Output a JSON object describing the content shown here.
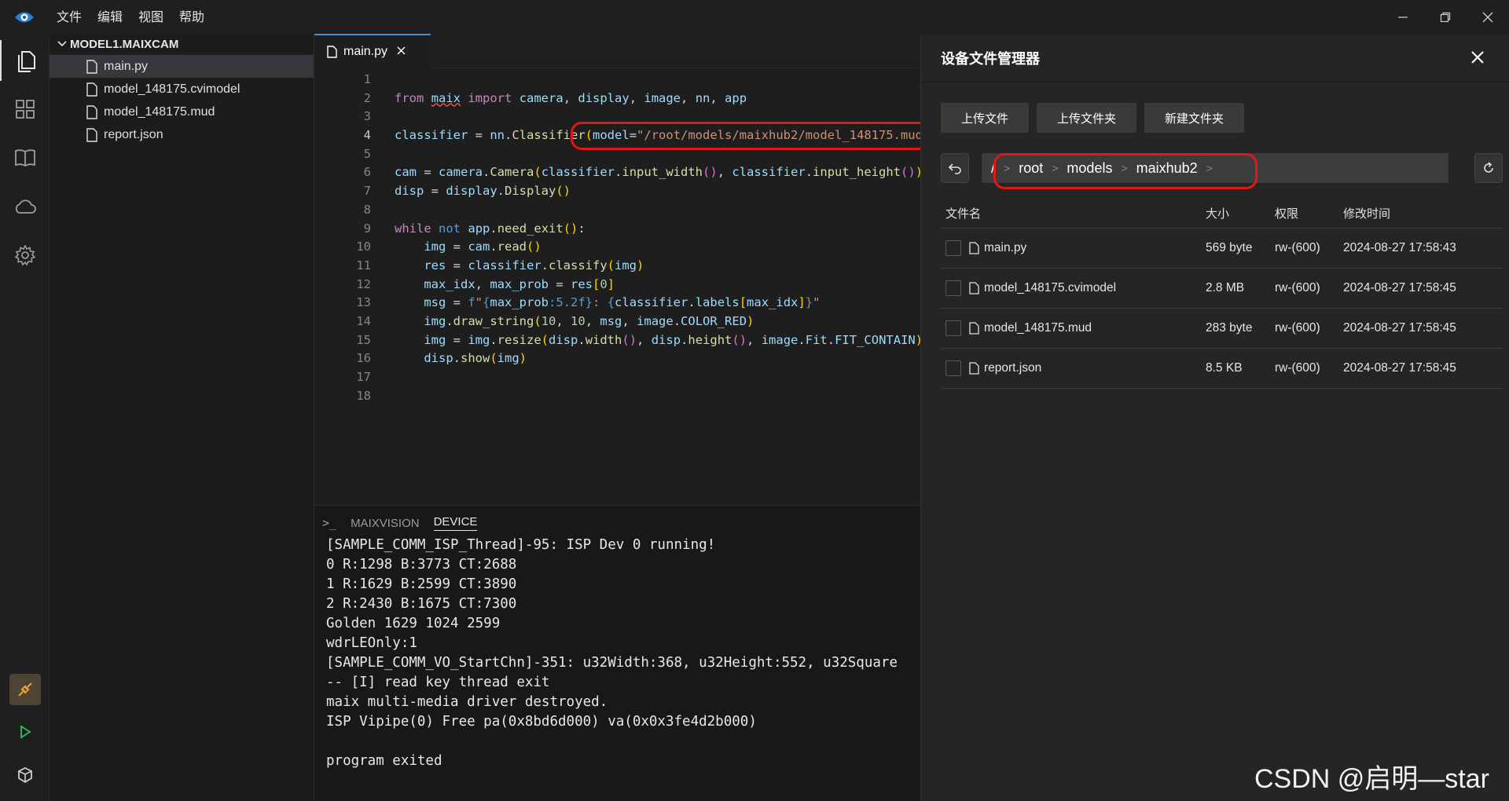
{
  "menu": [
    "文件",
    "编辑",
    "视图",
    "帮助"
  ],
  "explorer": {
    "title": "MODEL1.MAIXCAM",
    "files": [
      "main.py",
      "model_148175.cvimodel",
      "model_148175.mud",
      "report.json"
    ]
  },
  "editor": {
    "tab_label": "main.py",
    "line_numbers": [
      "1",
      "2",
      "3",
      "4",
      "5",
      "6",
      "7",
      "8",
      "9",
      "10",
      "11",
      "12",
      "13",
      "14",
      "15",
      "16",
      "17",
      "18"
    ],
    "current_line": 4
  },
  "panel": {
    "tabs": [
      "MAIXVISION",
      "DEVICE"
    ],
    "active_tab": "DEVICE",
    "output": [
      "[SAMPLE_COMM_ISP_Thread]-95: ISP Dev 0 running!",
      "0 R:1298 B:3773 CT:2688",
      "1 R:1629 B:2599 CT:3890",
      "2 R:2430 B:1675 CT:7300",
      "Golden 1629 1024 2599",
      "wdrLEOnly:1",
      "[SAMPLE_COMM_VO_StartChn]-351: u32Width:368, u32Height:552, u32Square",
      "-- [I] read key thread exit",
      "maix multi-media driver destroyed.",
      "ISP Vipipe(0) Free pa(0x8bd6d000) va(0x0x3fe4d2b000)",
      "",
      "program exited"
    ]
  },
  "file_manager": {
    "title": "设备文件管理器",
    "buttons": {
      "upload_file": "上传文件",
      "upload_folder": "上传文件夹",
      "new_folder": "新建文件夹"
    },
    "path": {
      "root_sep": "/",
      "segments": [
        "root",
        "models",
        "maixhub2"
      ]
    },
    "columns": {
      "name": "文件名",
      "size": "大小",
      "permission": "权限",
      "modified": "修改时间"
    },
    "rows": [
      {
        "name": "main.py",
        "size": "569 byte",
        "permission": "rw-(600)",
        "modified": "2024-08-27 17:58:43"
      },
      {
        "name": "model_148175.cvimodel",
        "size": "2.8 MB",
        "permission": "rw-(600)",
        "modified": "2024-08-27 17:58:45"
      },
      {
        "name": "model_148175.mud",
        "size": "283 byte",
        "permission": "rw-(600)",
        "modified": "2024-08-27 17:58:45"
      },
      {
        "name": "report.json",
        "size": "8.5 KB",
        "permission": "rw-(600)",
        "modified": "2024-08-27 17:58:45"
      }
    ]
  },
  "watermark": "CSDN @启明—star",
  "colors": {
    "accent": "#3c8fd6",
    "annotation": "#e01818",
    "keyword": "#c586c0",
    "string": "#ce9178"
  }
}
